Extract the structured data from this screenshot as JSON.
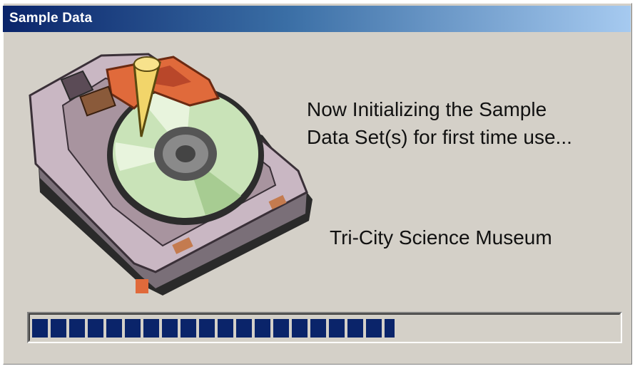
{
  "window": {
    "title": "Sample Data"
  },
  "main": {
    "message_line1": "Now Initializing the Sample",
    "message_line2": "Data Set(s) for first time use...",
    "organization": "Tri-City Science Museum",
    "illustration_icon": "hard-drive-icon"
  },
  "progress": {
    "fraction": 0.62
  },
  "colors": {
    "titlebar_start": "#0a246a",
    "titlebar_end": "#a6caf0",
    "dialog_background": "#d4d0c8",
    "progress_block": "#0a246a"
  }
}
